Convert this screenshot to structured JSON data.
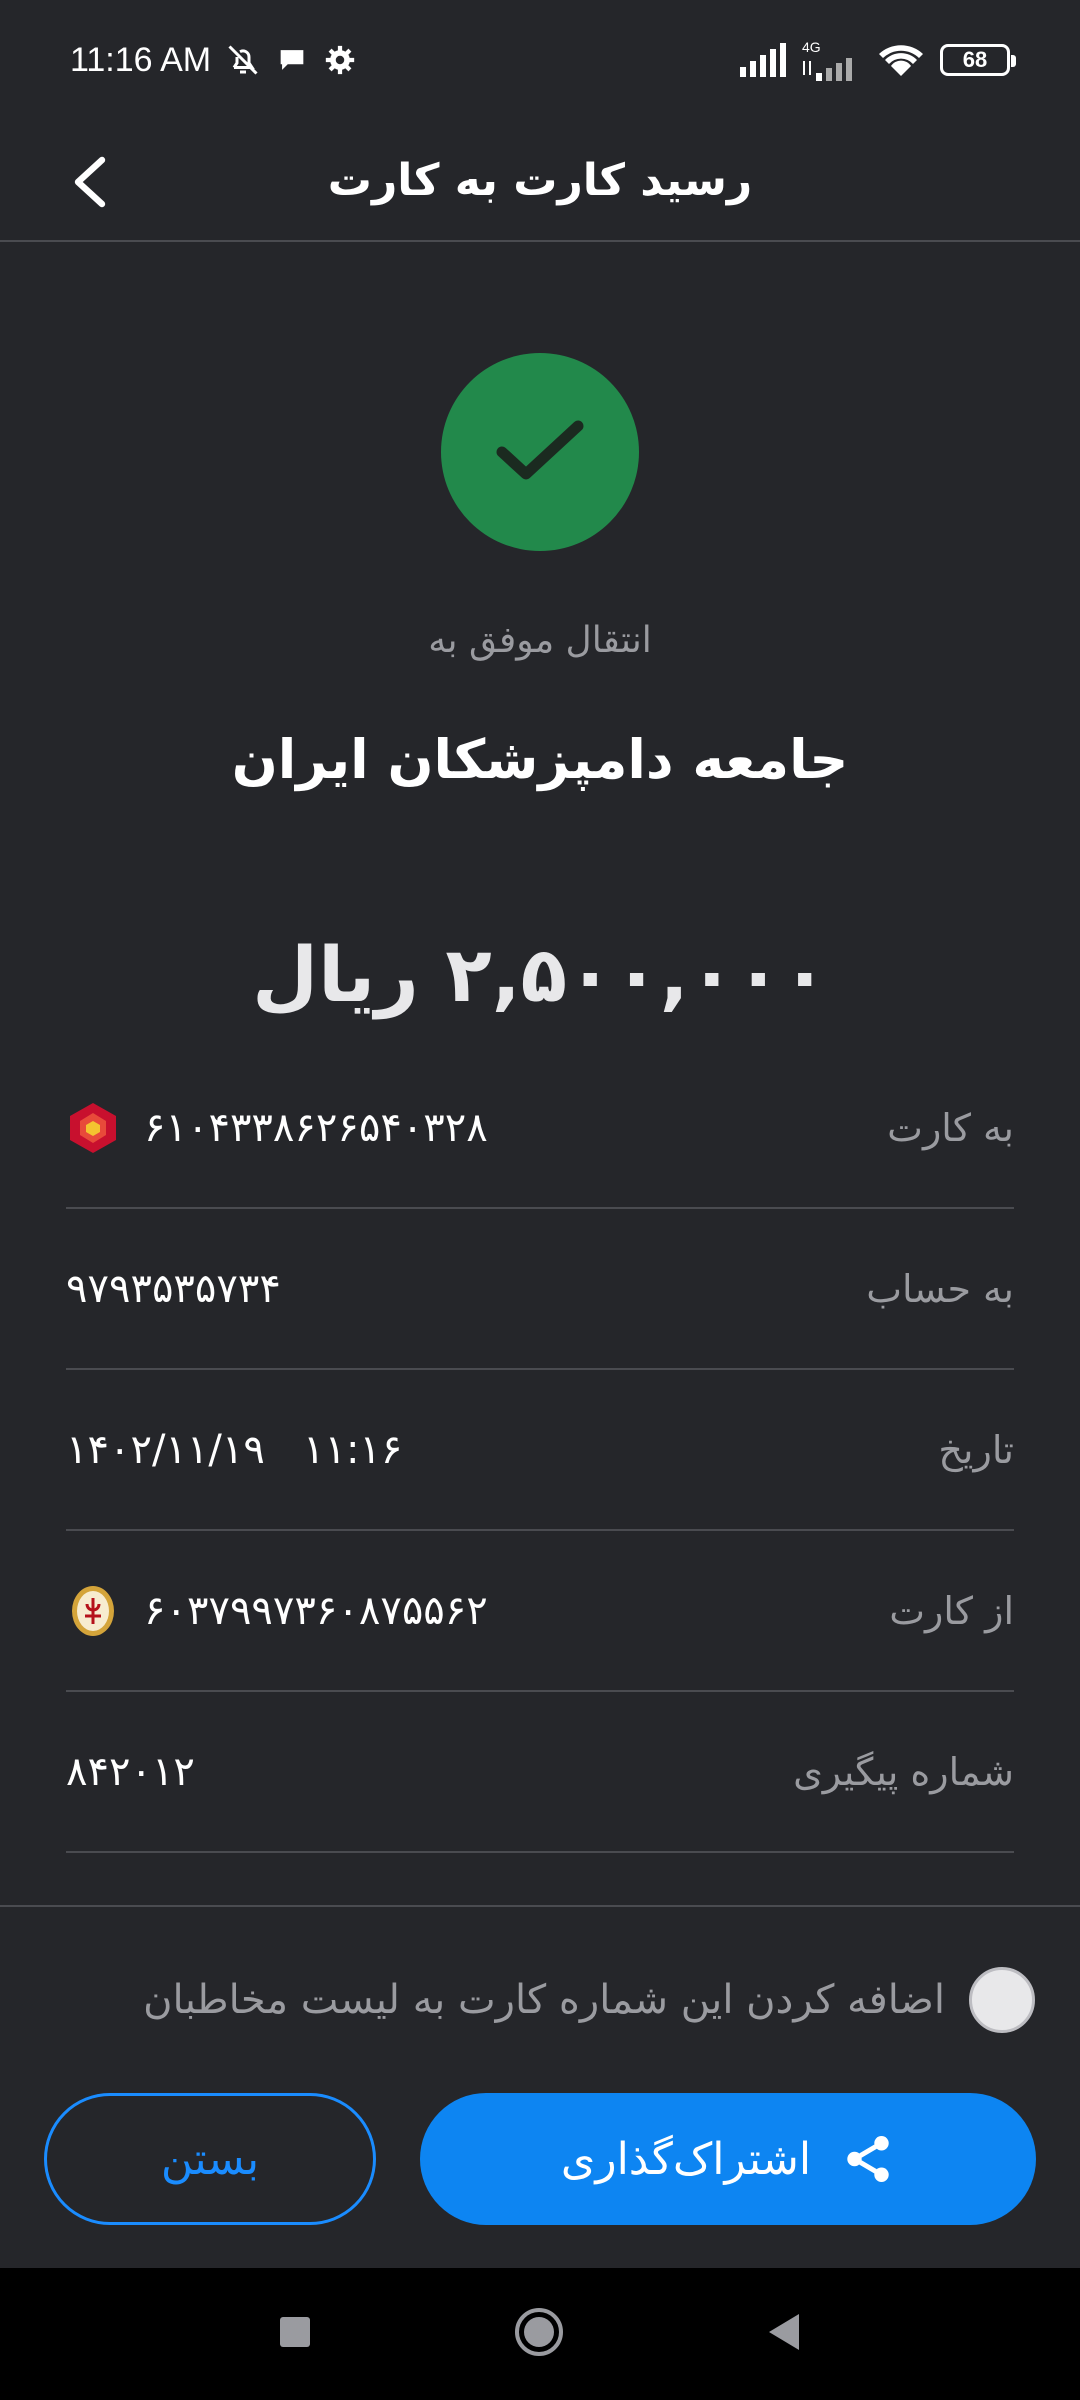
{
  "status_bar": {
    "time": "11:16 AM",
    "network": "4G",
    "battery": "68",
    "icons": [
      "bell-off-icon",
      "chat-icon",
      "gear-icon",
      "signal-icon",
      "signal-4g-icon",
      "wifi-icon"
    ]
  },
  "header": {
    "title": "رسید کارت به کارت",
    "back_icon": "chevron-left-icon"
  },
  "receipt": {
    "status_icon": "check-icon",
    "status_color": "#22894b",
    "transfer_label": "انتقال موفق به",
    "recipient_name": "جامعه دامپزشکان ایران",
    "amount": "۲,۵۰۰,۰۰۰ ریال"
  },
  "details": [
    {
      "label": "به کارت",
      "value": "۶۱۰۴۳۳۸۶۲۶۵۴۰۳۲۸",
      "icon": "bank-mellat-logo"
    },
    {
      "label": "به حساب",
      "value": "۹۷۹۳۵۳۵۷۳۴"
    },
    {
      "label": "تاریخ",
      "value": "۱۴۰۲/۱۱/۱۹   ۱۱:۱۶"
    },
    {
      "label": "از کارت",
      "value": "۶۰۳۷۹۹۷۳۶۰۸۷۵۵۶۲",
      "icon": "bank-melli-logo"
    },
    {
      "label": "شماره پیگیری",
      "value": "۸۴۲۰۱۲"
    }
  ],
  "contact_option": {
    "label": "اضافه کردن این شماره کارت به لیست مخاطبان",
    "checked": false
  },
  "buttons": {
    "share_label": "اشتراک‌گذاری",
    "close_label": "بستن",
    "accent_color": "#0d85f2"
  },
  "nav_bar": {
    "icons": [
      "recents-icon",
      "home-icon",
      "back-icon"
    ]
  }
}
